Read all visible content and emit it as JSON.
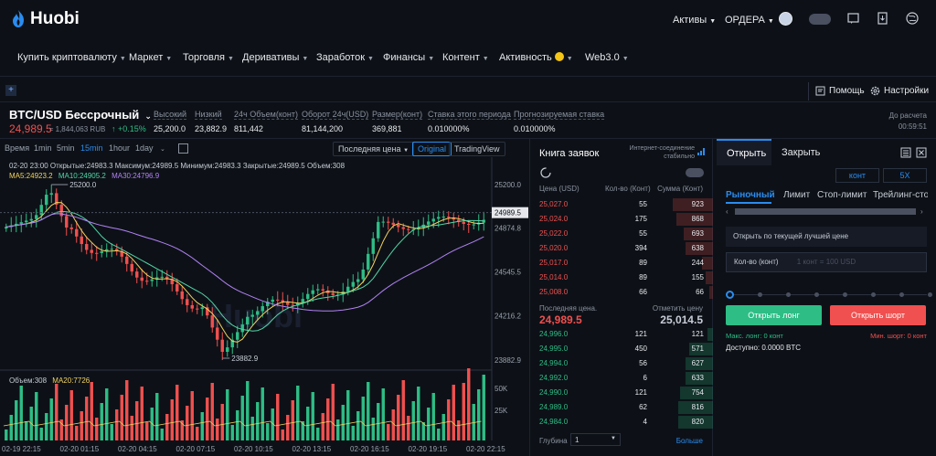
{
  "header": {
    "logo": "Huobi",
    "assets": "Активы",
    "orders": "ОРДЕРА"
  },
  "nav": [
    {
      "label": "Купить криптовалюту"
    },
    {
      "label": "Маркет"
    },
    {
      "label": "Торговля"
    },
    {
      "label": "Деривативы"
    },
    {
      "label": "Заработок"
    },
    {
      "label": "Финансы"
    },
    {
      "label": "Контент"
    },
    {
      "label": "Активность"
    },
    {
      "label": "Web3.0"
    }
  ],
  "toolbar": {
    "help": "Помощь",
    "settings": "Настройки"
  },
  "ticker": {
    "symbol": "BTC/USD Бессрочный",
    "price": "24,989.5",
    "rub": "≈ 1,844,063 RUB",
    "change": "+0.15%",
    "stats": [
      {
        "label": "Высокий",
        "value": "25,200.0"
      },
      {
        "label": "Низкий",
        "value": "23,882.9"
      },
      {
        "label": "24ч Объем(конт)",
        "value": "811,442"
      },
      {
        "label": "Оборот 24ч(USD)",
        "value": "81,144,200"
      },
      {
        "label": "Размер(конт)",
        "value": "369,881"
      },
      {
        "label": "Ставка этого периода",
        "value": "0.010000%"
      },
      {
        "label": "Прогнозируемая ставка",
        "value": "0.010000%"
      }
    ],
    "countdown_label": "До расчета",
    "countdown": "00:59:51"
  },
  "chart": {
    "timeframes": [
      "Время",
      "1min",
      "5min",
      "15min",
      "1hour",
      "1day"
    ],
    "active_timeframe": "15min",
    "price_type": "Последняя цена",
    "views": [
      "Original",
      "TradingView"
    ],
    "ohlc_line": "02-20 23:00  Открытые:24983.3  Максимум:24989.5  Минимум:24983.3  Закрытые:24989.5  Объем:308",
    "ma5": "MA5:24923.2",
    "ma10": "MA10:24905.2",
    "ma30": "MA30:24796.9",
    "high_marker": "25200.0",
    "low_marker": "23882.9",
    "vol_label": "Объем:308",
    "ma20_label": "MA20:7726",
    "price_axis": [
      "25200.0",
      "24874.8",
      "24545.5",
      "24216.2",
      "23882.9"
    ],
    "current_price_tag": "24989.5",
    "vol_axis": [
      "50K",
      "25K"
    ],
    "time_axis": [
      "02-19 22:15",
      "02-20 01:15",
      "02-20 04:15",
      "02-20 07:15",
      "02-20 10:15",
      "02-20 13:15",
      "02-20 16:15",
      "02-20 19:15",
      "02-20 22:15"
    ],
    "watermark": "Huobi"
  },
  "chart_data": {
    "type": "candlestick",
    "ylim": [
      23882.9,
      25200.0
    ],
    "high": 25200.0,
    "low": 23882.9,
    "last": 24989.5
  },
  "orderbook": {
    "title": "Книга заявок",
    "conn_status": "Интернет-соединение стабильно",
    "headers": [
      "Цена (USD)",
      "Кол-во (Конт)",
      "Сумма (Конт)"
    ],
    "asks": [
      {
        "price": "25,027.0",
        "qty": "55",
        "sum": "923",
        "depth": 0.22
      },
      {
        "price": "25,024.0",
        "qty": "175",
        "sum": "868",
        "depth": 0.2
      },
      {
        "price": "25,022.0",
        "qty": "55",
        "sum": "693",
        "depth": 0.16
      },
      {
        "price": "25,020.0",
        "qty": "394",
        "sum": "638",
        "depth": 0.15
      },
      {
        "price": "25,017.0",
        "qty": "89",
        "sum": "244",
        "depth": 0.06
      },
      {
        "price": "25,014.0",
        "qty": "89",
        "sum": "155",
        "depth": 0.04
      },
      {
        "price": "25,008.0",
        "qty": "66",
        "sum": "66",
        "depth": 0.02
      }
    ],
    "last_label": "Последняя цена.",
    "last_price": "24,989.5",
    "mark_label": "Отметить цену",
    "mark_price": "25,014.5",
    "bids": [
      {
        "price": "24,996.0",
        "qty": "121",
        "sum": "121",
        "depth": 0.03
      },
      {
        "price": "24,995.0",
        "qty": "450",
        "sum": "571",
        "depth": 0.13
      },
      {
        "price": "24,994.0",
        "qty": "56",
        "sum": "627",
        "depth": 0.15
      },
      {
        "price": "24,992.0",
        "qty": "6",
        "sum": "633",
        "depth": 0.15
      },
      {
        "price": "24,990.0",
        "qty": "121",
        "sum": "754",
        "depth": 0.18
      },
      {
        "price": "24,989.0",
        "qty": "62",
        "sum": "816",
        "depth": 0.19
      },
      {
        "price": "24,984.0",
        "qty": "4",
        "sum": "820",
        "depth": 0.19
      }
    ],
    "depth_label": "Глубина",
    "depth_value": "1",
    "more": "Больше"
  },
  "trade": {
    "tabs": [
      "Открыть",
      "Закрыть"
    ],
    "unit": "конт",
    "leverage": "5X",
    "order_types": [
      "Рыночный",
      "Лимит",
      "Стоп-лимит",
      "Трейлинг-сто"
    ],
    "price_placeholder": "Открыть по текущей лучшей цене",
    "qty_label": "Кол-во (конт)",
    "qty_placeholder": "1 конт = 100 USD",
    "long_btn": "Открыть лонг",
    "short_btn": "Открыть шорт",
    "max_long": "Макс. лонг: 0 конт",
    "max_short": "Мин. шорт: 0 конт",
    "available": "Доступно: 0.0000 BTC"
  },
  "colors": {
    "up": "#2ebd85",
    "down": "#f0504f",
    "accent": "#00b0ff"
  }
}
